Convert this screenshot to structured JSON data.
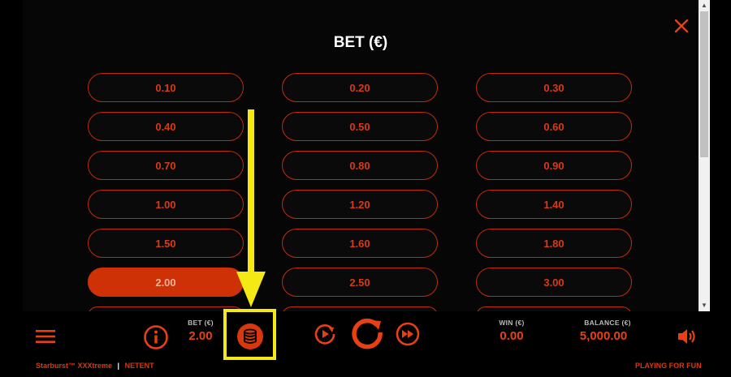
{
  "bet_panel": {
    "title": "BET (€)",
    "options": [
      "0.10",
      "0.20",
      "0.30",
      "0.40",
      "0.50",
      "0.60",
      "0.70",
      "0.80",
      "0.90",
      "1.00",
      "1.20",
      "1.40",
      "1.50",
      "1.60",
      "1.80",
      "2.00",
      "2.50",
      "3.00"
    ],
    "selected": "2.00"
  },
  "toolbar": {
    "bet_label": "BET (€)",
    "bet_value": "2.00",
    "win_label": "WIN (€)",
    "win_value": "0.00",
    "balance_label": "BALANCE (€)",
    "balance_value": "5,000.00"
  },
  "footer": {
    "game": "Starburst™ XXXtreme",
    "separator": "|",
    "provider": "NETENT",
    "mode": "PLAYING FOR FUN"
  },
  "icons": [
    "close-icon",
    "menu-icon",
    "info-icon",
    "coins-icon",
    "autoplay-icon",
    "spin-icon",
    "turbo-icon",
    "sound-icon"
  ],
  "colors": {
    "accent": "#d8380f",
    "selected_bg": "#cf3107",
    "annotation": "#f4e815"
  }
}
